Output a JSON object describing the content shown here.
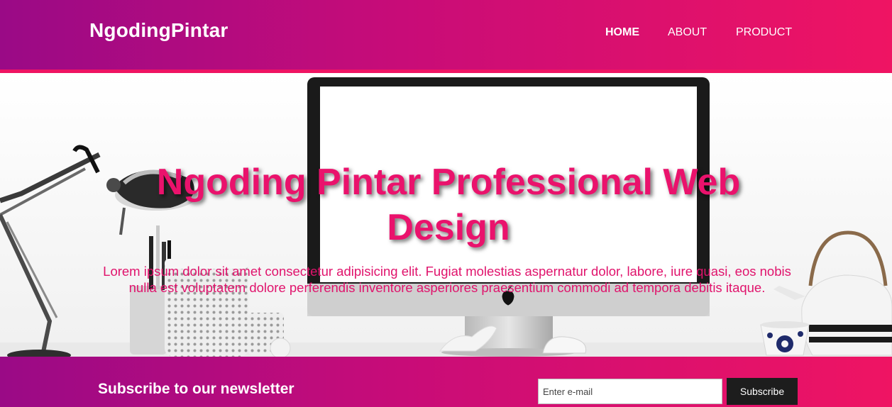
{
  "header": {
    "brand": "NgodingPintar",
    "nav": [
      {
        "label": "HOME",
        "active": true
      },
      {
        "label": "ABOUT",
        "active": false
      },
      {
        "label": "PRODUCT",
        "active": false
      }
    ]
  },
  "hero": {
    "title": "Ngoding Pintar Professional Web Design",
    "text": "Lorem ipsum dolor sit amet consectetur adipisicing elit. Fugiat molestias aspernatur dolor, labore, iure quasi, eos nobis nulla est voluptatem dolore perferendis inventore asperiores praesentium commodi ad tempora debitis itaque.",
    "image_icon": "desk-workspace-photo"
  },
  "newsletter": {
    "title": "Subscribe to our newsletter",
    "email_placeholder": "Enter e-mail",
    "button_label": "Subscribe"
  },
  "colors": {
    "gradient_start": "#9a0a86",
    "gradient_end": "#ef1463",
    "accent": "#ea126c",
    "button_bg": "#1d1d1d"
  }
}
